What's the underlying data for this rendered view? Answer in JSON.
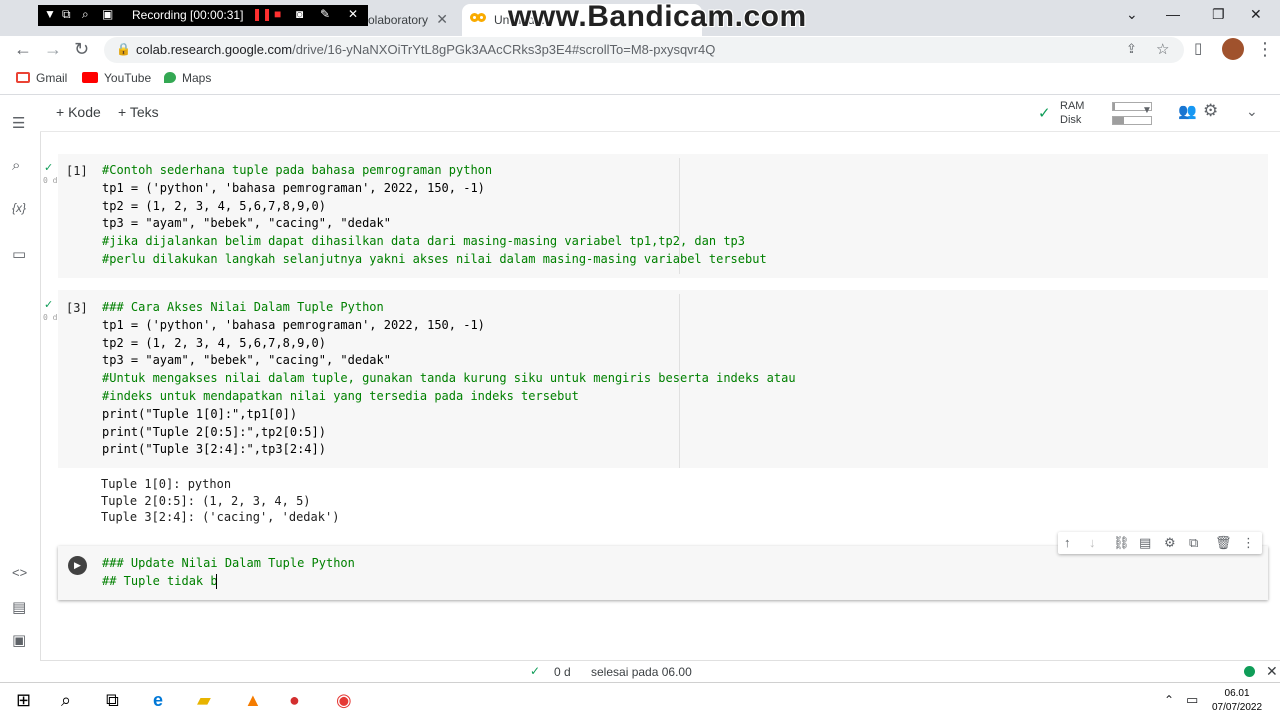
{
  "browser": {
    "tabs": [
      {
        "label": "olaboratory"
      },
      {
        "label": "Untitled..."
      }
    ],
    "url_host": "colab.research.google.com",
    "url_path": "/drive/16-yNaNXOiTrYtL8gPGk3AAcCRks3p3E4#scrollTo=M8-pxysqvr4Q",
    "bookmarks": [
      {
        "label": "Gmail"
      },
      {
        "label": "YouTube"
      },
      {
        "label": "Maps"
      }
    ]
  },
  "recorder": {
    "status": "Recording [00:00:31]",
    "watermark": "www.Bandicam.com"
  },
  "toolbar": {
    "add_code": "+ Kode",
    "add_text": "+ Teks",
    "ram_label": "RAM",
    "disk_label": "Disk",
    "ram_fraction": 0.05,
    "disk_fraction": 0.3
  },
  "cells": [
    {
      "number": "[1]",
      "duration": "0 d",
      "lines": [
        "#Contoh sederhana tuple pada bahasa pemrograman python",
        "tp1 = ('python', 'bahasa pemrograman', 2022, 150, -1)",
        "tp2 = (1, 2, 3, 4, 5,6,7,8,9,0)",
        "tp3 = \"ayam\", \"bebek\", \"cacing\", \"dedak\"",
        "#jika dijalankan belim dapat dihasilkan data dari masing-masing variabel tp1,tp2, dan tp3",
        "#perlu dilakukan langkah selanjutnya yakni akses nilai dalam masing-masing variabel tersebut"
      ]
    },
    {
      "number": "[3]",
      "duration": "0 d",
      "lines": [
        "### Cara Akses Nilai Dalam Tuple Python",
        "tp1 = ('python', 'bahasa pemrograman', 2022, 150, -1)",
        "tp2 = (1, 2, 3, 4, 5,6,7,8,9,0)",
        "tp3 = \"ayam\", \"bebek\", \"cacing\", \"dedak\"",
        "#Untuk mengakses nilai dalam tuple, gunakan tanda kurung siku untuk mengiris beserta indeks atau",
        "#indeks untuk mendapatkan nilai yang tersedia pada indeks tersebut",
        "print(\"Tuple 1[0]:\",tp1[0])",
        "print(\"Tuple 2[0:5]:\",tp2[0:5])",
        "print(\"Tuple 3[2:4]:\",tp3[2:4])"
      ],
      "output": [
        "Tuple 1[0]: python",
        "Tuple 2[0:5]: (1, 2, 3, 4, 5)",
        "Tuple 3[2:4]: ('cacing', 'dedak')"
      ]
    },
    {
      "lines": [
        "### Update Nilai Dalam Tuple Python",
        "## Tuple tidak b"
      ]
    }
  ],
  "status": {
    "elapsed": "0 d",
    "message": "selesai pada 06.00"
  },
  "taskbar": {
    "time": "06.01",
    "date": "07/07/2022"
  }
}
